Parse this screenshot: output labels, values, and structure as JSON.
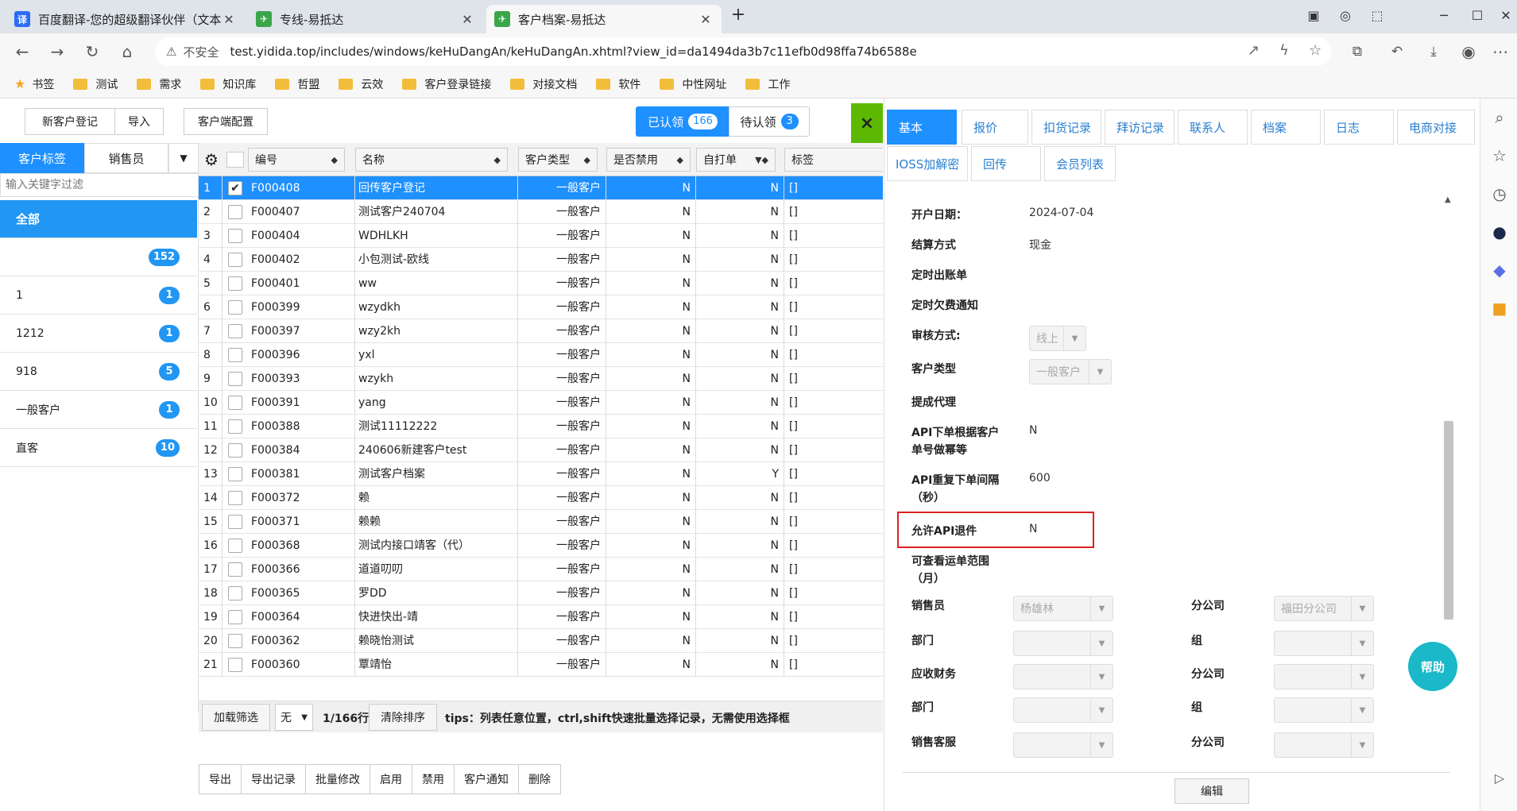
{
  "browser": {
    "tabs": [
      {
        "title": "百度翻译-您的超级翻译伙伴（文本…",
        "fav": "译",
        "fav_color": "#2b6cf6"
      },
      {
        "title": "专线-易抵达",
        "fav": "✈",
        "fav_color": "#3aa64a"
      },
      {
        "title": "客户档案-易抵达",
        "fav": "✈",
        "fav_color": "#3aa64a"
      }
    ],
    "insecure_label": "不安全",
    "url": "test.yidida.top/includes/windows/keHuDangAn/keHuDangAn.xhtml?view_id=da1494da3b7c11efb0d98ffa74b6588e",
    "bookmarks": [
      "书签",
      "测试",
      "需求",
      "知识库",
      "哲盟",
      "云效",
      "客户登录链接",
      "对接文档",
      "软件",
      "中性网址",
      "工作"
    ]
  },
  "toolbar": {
    "new_customer": "新客户登记",
    "import": "导入",
    "client_config": "客户端配置",
    "claimed_label": "已认领",
    "claimed_count": "166",
    "pending_label": "待认领",
    "pending_count": "3",
    "close": "×"
  },
  "left": {
    "tab_tags": "客户标签",
    "tab_sales": "销售员",
    "filter_placeholder": "输入关键字过滤",
    "items": [
      {
        "label": "全部",
        "count": ""
      },
      {
        "label": "",
        "count": "152"
      },
      {
        "label": "1",
        "count": "1"
      },
      {
        "label": "1212",
        "count": "1"
      },
      {
        "label": "918",
        "count": "5"
      },
      {
        "label": "一般客户",
        "count": "1"
      },
      {
        "label": "直客",
        "count": "10"
      }
    ]
  },
  "grid": {
    "headers": {
      "code": "编号",
      "name": "名称",
      "type": "客户类型",
      "disabled": "是否禁用",
      "selfprint": "自打单",
      "tag": "标签"
    },
    "rows": [
      {
        "n": "1",
        "code": "F000408",
        "name": "回传客户登记",
        "type": "一般客户",
        "dis": "N",
        "sp": "N",
        "tag": "[]"
      },
      {
        "n": "2",
        "code": "F000407",
        "name": "测试客户240704",
        "type": "一般客户",
        "dis": "N",
        "sp": "N",
        "tag": "[]"
      },
      {
        "n": "3",
        "code": "F000404",
        "name": "WDHLKH",
        "type": "一般客户",
        "dis": "N",
        "sp": "N",
        "tag": "[]"
      },
      {
        "n": "4",
        "code": "F000402",
        "name": "小包测试-欧线",
        "type": "一般客户",
        "dis": "N",
        "sp": "N",
        "tag": "[]"
      },
      {
        "n": "5",
        "code": "F000401",
        "name": "ww",
        "type": "一般客户",
        "dis": "N",
        "sp": "N",
        "tag": "[]"
      },
      {
        "n": "6",
        "code": "F000399",
        "name": "wzydkh",
        "type": "一般客户",
        "dis": "N",
        "sp": "N",
        "tag": "[]"
      },
      {
        "n": "7",
        "code": "F000397",
        "name": "wzy2kh",
        "type": "一般客户",
        "dis": "N",
        "sp": "N",
        "tag": "[]"
      },
      {
        "n": "8",
        "code": "F000396",
        "name": "yxl",
        "type": "一般客户",
        "dis": "N",
        "sp": "N",
        "tag": "[]"
      },
      {
        "n": "9",
        "code": "F000393",
        "name": "wzykh",
        "type": "一般客户",
        "dis": "N",
        "sp": "N",
        "tag": "[]"
      },
      {
        "n": "10",
        "code": "F000391",
        "name": "yang",
        "type": "一般客户",
        "dis": "N",
        "sp": "N",
        "tag": "[]"
      },
      {
        "n": "11",
        "code": "F000388",
        "name": "测试11112222",
        "type": "一般客户",
        "dis": "N",
        "sp": "N",
        "tag": "[]"
      },
      {
        "n": "12",
        "code": "F000384",
        "name": "240606新建客户test",
        "type": "一般客户",
        "dis": "N",
        "sp": "N",
        "tag": "[]"
      },
      {
        "n": "13",
        "code": "F000381",
        "name": "测试客户档案",
        "type": "一般客户",
        "dis": "N",
        "sp": "Y",
        "tag": "[]"
      },
      {
        "n": "14",
        "code": "F000372",
        "name": "赖",
        "type": "一般客户",
        "dis": "N",
        "sp": "N",
        "tag": "[]"
      },
      {
        "n": "15",
        "code": "F000371",
        "name": "赖赖",
        "type": "一般客户",
        "dis": "N",
        "sp": "N",
        "tag": "[]"
      },
      {
        "n": "16",
        "code": "F000368",
        "name": "测试内接口靖客（代）",
        "type": "一般客户",
        "dis": "N",
        "sp": "N",
        "tag": "[]"
      },
      {
        "n": "17",
        "code": "F000366",
        "name": "道道叨叨",
        "type": "一般客户",
        "dis": "N",
        "sp": "N",
        "tag": "[]"
      },
      {
        "n": "18",
        "code": "F000365",
        "name": "罗DD",
        "type": "一般客户",
        "dis": "N",
        "sp": "N",
        "tag": "[]"
      },
      {
        "n": "19",
        "code": "F000364",
        "name": "快进快出-靖",
        "type": "一般客户",
        "dis": "N",
        "sp": "N",
        "tag": "[]"
      },
      {
        "n": "20",
        "code": "F000362",
        "name": "赖晓怡测试",
        "type": "一般客户",
        "dis": "N",
        "sp": "N",
        "tag": "[]"
      },
      {
        "n": "21",
        "code": "F000360",
        "name": "覃靖怡",
        "type": "一般客户",
        "dis": "N",
        "sp": "N",
        "tag": "[]"
      }
    ],
    "footer": {
      "load_filter": "加载筛选",
      "none": "无",
      "count": "1/166行",
      "clear_sort": "清除排序",
      "tips": "tips：列表任意位置，ctrl,shift快速批量选择记录，无需使用选择框"
    },
    "actions": [
      "导出",
      "导出记录",
      "批量修改",
      "启用",
      "禁用",
      "客户通知",
      "删除"
    ]
  },
  "detail": {
    "tabs_row1": [
      "基本",
      "报价",
      "扣货记录",
      "拜访记录",
      "联系人",
      "档案",
      "日志",
      "电商对接"
    ],
    "tabs_row2": [
      "IOSS加解密",
      "回传",
      "会员列表"
    ],
    "fields": {
      "open_date_label": "开户日期：",
      "open_date": "2024-07-04",
      "settle_label": "结算方式",
      "settle": "现金",
      "timed_bill_label": "定时出账单",
      "timed_arrears_label": "定时欠费通知",
      "audit_label": "审核方式:",
      "audit": "线上",
      "cust_type_label": "客户类型",
      "cust_type": "一般客户",
      "agent_label": "提成代理",
      "api_dedup_label": "API下单根据客户单号做幂等",
      "api_dedup": "N",
      "api_interval_label": "API重复下单间隔（秒）",
      "api_interval": "600",
      "api_return_label": "允许API退件",
      "api_return": "N",
      "waybill_range_label": "可查看运单范围（月）",
      "sales_label": "销售员",
      "sales": "杨雄林",
      "branch_label": "分公司",
      "branch": "福田分公司",
      "dept_label": "部门",
      "group_label": "组",
      "ar_label": "应收财务",
      "branch2_label": "分公司",
      "dept2_label": "部门",
      "group2_label": "组",
      "cs_label": "销售客服",
      "branch3_label": "分公司"
    },
    "edit": "编辑",
    "help": "帮助",
    "highlight_color": "#e02020"
  }
}
